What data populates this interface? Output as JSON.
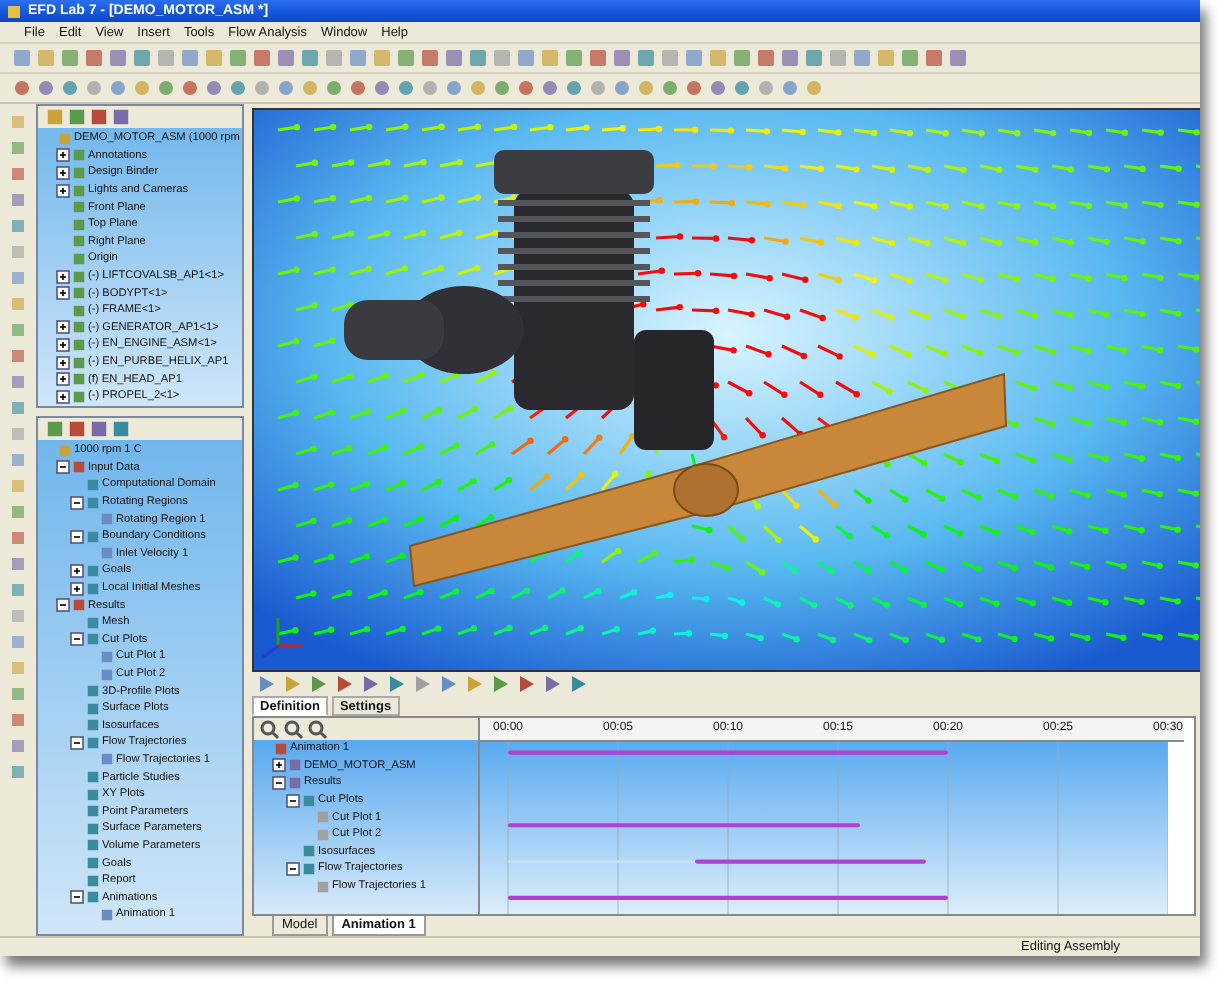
{
  "window": {
    "title": "EFD Lab 7 - [DEMO_MOTOR_ASM *]"
  },
  "menu": [
    "File",
    "Edit",
    "View",
    "Insert",
    "Tools",
    "Flow Analysis",
    "Window",
    "Help"
  ],
  "feature_tree": [
    {
      "label": "DEMO_MOTOR_ASM (1000 rpm",
      "children": [
        {
          "label": "Annotations",
          "expanded": false
        },
        {
          "label": "Design Binder",
          "expanded": false
        },
        {
          "label": "Lights and Cameras",
          "expanded": false
        },
        {
          "label": "Front Plane"
        },
        {
          "label": "Top Plane"
        },
        {
          "label": "Right Plane"
        },
        {
          "label": "Origin"
        },
        {
          "label": "(-) LIFTCOVALSB_AP1<1>",
          "expanded": false
        },
        {
          "label": "(-) BODYPT<1>",
          "expanded": false
        },
        {
          "label": "(-) FRAME<1>"
        },
        {
          "label": "(-) GENERATOR_AP1<1>",
          "expanded": false
        },
        {
          "label": "(-) EN_ENGINE_ASM<1>",
          "expanded": false
        },
        {
          "label": "(-) EN_PURBE_HELIX_AP1",
          "expanded": false
        },
        {
          "label": "(f) EN_HEAD_AP1",
          "expanded": false
        },
        {
          "label": "(-) PROPEL_2<1>",
          "expanded": false
        }
      ]
    }
  ],
  "analysis_tree": [
    {
      "label": "1000 rpm 1 C",
      "children": [
        {
          "label": "Input Data",
          "expanded": true,
          "children": [
            {
              "label": "Computational Domain"
            },
            {
              "label": "Rotating Regions",
              "expanded": true,
              "children": [
                {
                  "label": "Rotating Region 1"
                }
              ]
            },
            {
              "label": "Boundary Conditions",
              "expanded": true,
              "children": [
                {
                  "label": "Inlet Velocity 1"
                }
              ]
            },
            {
              "label": "Goals",
              "expanded": false
            },
            {
              "label": "Local Initial Meshes",
              "expanded": false
            }
          ]
        },
        {
          "label": "Results",
          "expanded": true,
          "children": [
            {
              "label": "Mesh"
            },
            {
              "label": "Cut Plots",
              "expanded": true,
              "children": [
                {
                  "label": "Cut Plot 1"
                },
                {
                  "label": "Cut Plot 2"
                }
              ]
            },
            {
              "label": "3D-Profile Plots"
            },
            {
              "label": "Surface Plots"
            },
            {
              "label": "Isosurfaces"
            },
            {
              "label": "Flow Trajectories",
              "expanded": true,
              "children": [
                {
                  "label": "Flow Trajectories 1"
                }
              ]
            },
            {
              "label": "Particle Studies"
            },
            {
              "label": "XY Plots"
            },
            {
              "label": "Point Parameters"
            },
            {
              "label": "Surface Parameters"
            },
            {
              "label": "Volume Parameters"
            },
            {
              "label": "Goals"
            },
            {
              "label": "Report"
            },
            {
              "label": "Animations",
              "expanded": true,
              "children": [
                {
                  "label": "Animation 1"
                }
              ]
            }
          ]
        }
      ]
    }
  ],
  "timeline": {
    "tabs": [
      {
        "label": "Definition",
        "selected": true
      },
      {
        "label": "Settings",
        "selected": false
      }
    ],
    "chart_data": {
      "type": "bar",
      "orientation": "horizontal",
      "stacked": true,
      "grid": true,
      "xlim": [
        0,
        30
      ],
      "xticks": [
        {
          "value": 0,
          "label": "00:00"
        },
        {
          "value": 5,
          "label": "00:05"
        },
        {
          "value": 10,
          "label": "00:10"
        },
        {
          "value": 15,
          "label": "00:15"
        },
        {
          "value": 20,
          "label": "00:20"
        },
        {
          "value": 25,
          "label": "00:25"
        },
        {
          "value": 30,
          "label": "00:30"
        }
      ],
      "series": [
        {
          "color": "#c8e4f8",
          "values": [
            0,
            null,
            null,
            null,
            0,
            null,
            8.5,
            null,
            0
          ]
        },
        {
          "color": "#b040d0",
          "values": [
            20,
            null,
            null,
            null,
            16,
            null,
            10.5,
            null,
            20
          ]
        }
      ]
    },
    "tree": [
      {
        "label": "Animation 1",
        "children": [
          {
            "label": "DEMO_MOTOR_ASM",
            "expanded": false
          },
          {
            "label": "Results",
            "expanded": true,
            "children": [
              {
                "label": "Cut Plots",
                "expanded": true,
                "children": [
                  {
                    "label": "Cut Plot 1"
                  },
                  {
                    "label": "Cut Plot 2"
                  }
                ]
              },
              {
                "label": "Isosurfaces"
              },
              {
                "label": "Flow Trajectories",
                "expanded": true,
                "children": [
                  {
                    "label": "Flow Trajectories 1"
                  }
                ]
              }
            ]
          }
        ]
      }
    ]
  },
  "document_tabs": [
    {
      "label": "Model",
      "selected": false
    },
    {
      "label": "Animation 1",
      "selected": true
    }
  ],
  "status_bar": {
    "text": "Editing Assembly"
  }
}
